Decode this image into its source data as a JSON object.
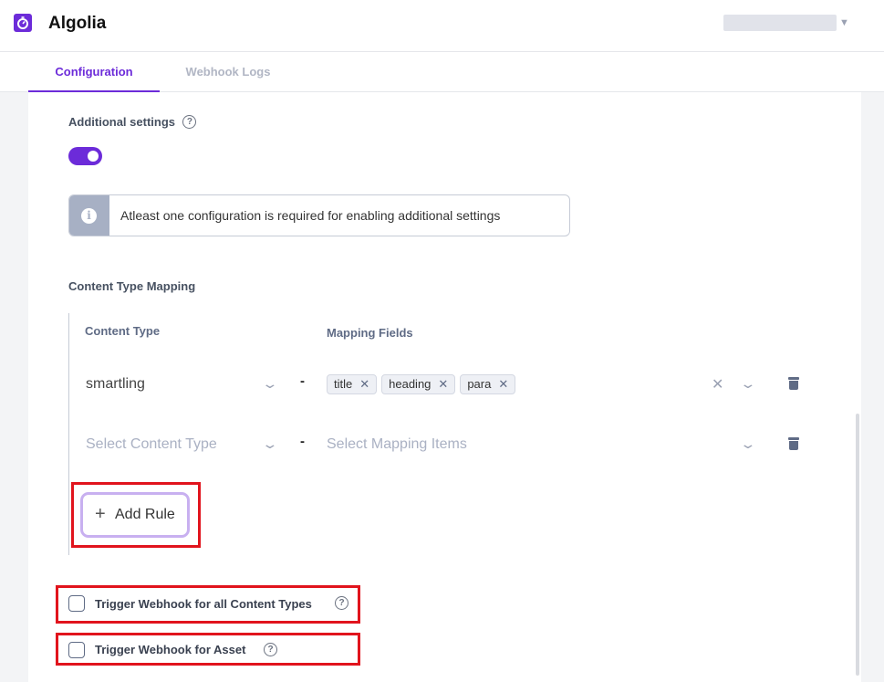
{
  "header": {
    "app_title": "Algolia",
    "logo_icon": "algolia-stopwatch-icon",
    "account_caret_icon": "caret-down-icon"
  },
  "tabs": [
    {
      "label": "Configuration",
      "active": true
    },
    {
      "label": "Webhook Logs",
      "active": false
    }
  ],
  "settings": {
    "additional_settings_label": "Additional settings",
    "toggle_on": true,
    "info_message": "Atleast one configuration is required for enabling additional settings"
  },
  "mapping": {
    "title": "Content Type Mapping",
    "content_type_header": "Content Type",
    "mapping_fields_header": "Mapping Fields",
    "separator": "-",
    "rules": [
      {
        "content_type": "smartling",
        "fields": [
          "title",
          "heading",
          "para"
        ]
      },
      {
        "content_type_placeholder": "Select Content Type",
        "fields_placeholder": "Select Mapping Items"
      }
    ],
    "add_rule_label": "Add Rule"
  },
  "triggers": {
    "all_content_types_label": "Trigger Webhook for all Content Types",
    "asset_label": "Trigger Webhook for Asset"
  },
  "colors": {
    "accent": "#6c2bd9",
    "highlight": "#e1141d"
  }
}
